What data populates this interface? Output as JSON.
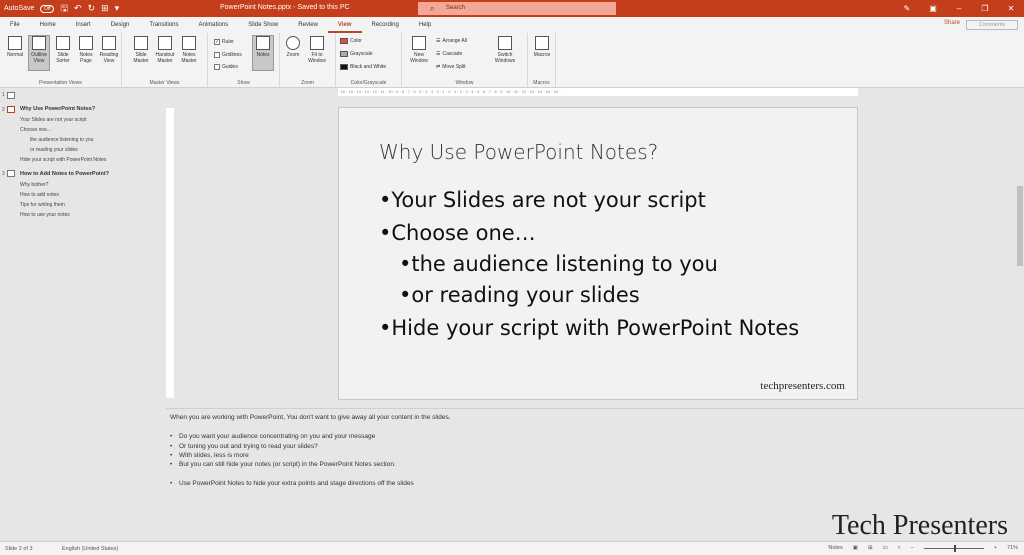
{
  "titlebar": {
    "autosave_label": "AutoSave",
    "autosave_state": "Off",
    "doc_title": "PowerPoint Notes.pptx - Saved to this PC",
    "search_placeholder": "Search"
  },
  "tabs": [
    "File",
    "Home",
    "Insert",
    "Design",
    "Transitions",
    "Animations",
    "Slide Show",
    "Review",
    "View",
    "Recording",
    "Help"
  ],
  "active_tab": "View",
  "share_label": "Share",
  "comments_label": "Comments",
  "ribbon": {
    "presentation_views": {
      "label": "Presentation Views",
      "normal": "Normal",
      "outline_view": "Outline View",
      "slide_sorter": "Slide Sorter",
      "notes_page": "Notes Page",
      "reading_view": "Reading View"
    },
    "master_views": {
      "label": "Master Views",
      "slide_master": "Slide Master",
      "handout_master": "Handout Master",
      "notes_master": "Notes Master"
    },
    "show": {
      "label": "Show",
      "ruler": "Ruler",
      "gridlines": "Gridlines",
      "guides": "Guides",
      "notes": "Notes"
    },
    "zoom": {
      "label": "Zoom",
      "zoom": "Zoom",
      "fit_to_window": "Fit to Window"
    },
    "color": {
      "label": "Color/Grayscale",
      "color": "Color",
      "grayscale": "Grayscale",
      "black_and_white": "Black and White"
    },
    "window": {
      "label": "Window",
      "new_window": "New Window",
      "arrange_all": "Arrange All",
      "cascade": "Cascade",
      "move_split": "Move Split",
      "switch_windows": "Switch Windows"
    },
    "macros": {
      "label": "Macros",
      "macros": "Macros"
    }
  },
  "ruler_text": "· 16 · 15 · 14 · 13 · 12 · 11 · 10 · 9 · 8 · 7 · 6 · 5 · 4 · 3 · 2 · 1 · 0 · 1 · 2 · 3 · 4 · 5 · 6 · 7 · 8 · 9 · 10 · 11 · 12 · 13 · 14 · 15 · 16 ·",
  "outline": {
    "slide1_num": "1",
    "slide2_num": "2",
    "slide2_title": "Why Use PowerPoint Notes?",
    "slide2_b1": "Your Slides are not your script",
    "slide2_b2": "Choose one...",
    "slide2_b3": "the audience listening to you",
    "slide2_b4": "or reading your slides",
    "slide2_b5": "Hide your script with PowerPoint Notes",
    "slide3_num": "3",
    "slide3_title": "How to Add Notes to PowerPoint?",
    "slide3_b1": "Why bother?",
    "slide3_b2": "How to add notes",
    "slide3_b3": "Tips for writing them",
    "slide3_b4": "How to use your notes"
  },
  "slide": {
    "title": "Why Use PowerPoint Notes?",
    "b1": "•Your Slides are not your script",
    "b2": "•Choose one…",
    "b3": "•the audience listening to you",
    "b4": "•or reading your slides",
    "b5": "•Hide your script with PowerPoint Notes",
    "footer": "techpresenters.com"
  },
  "notes": {
    "intro": "When you are working with PowerPoint, You don't want to give away all your content in the slides.",
    "b1": "Do you want your audience concentrating on you and your message",
    "b2": "Or tuning you out and trying to read your slides?",
    "b3": "With slides, less is more",
    "b4": "But you can still hide your notes (or script) in the PowerPoint Notes section.",
    "b5": "Use PowerPoint Notes to hide your extra points and stage directions off the slides"
  },
  "brand": "Tech Presenters",
  "status": {
    "slide_count": "Slide 2 of 3",
    "language": "English (United States)",
    "notes_button": "Notes",
    "zoom": "71%"
  }
}
